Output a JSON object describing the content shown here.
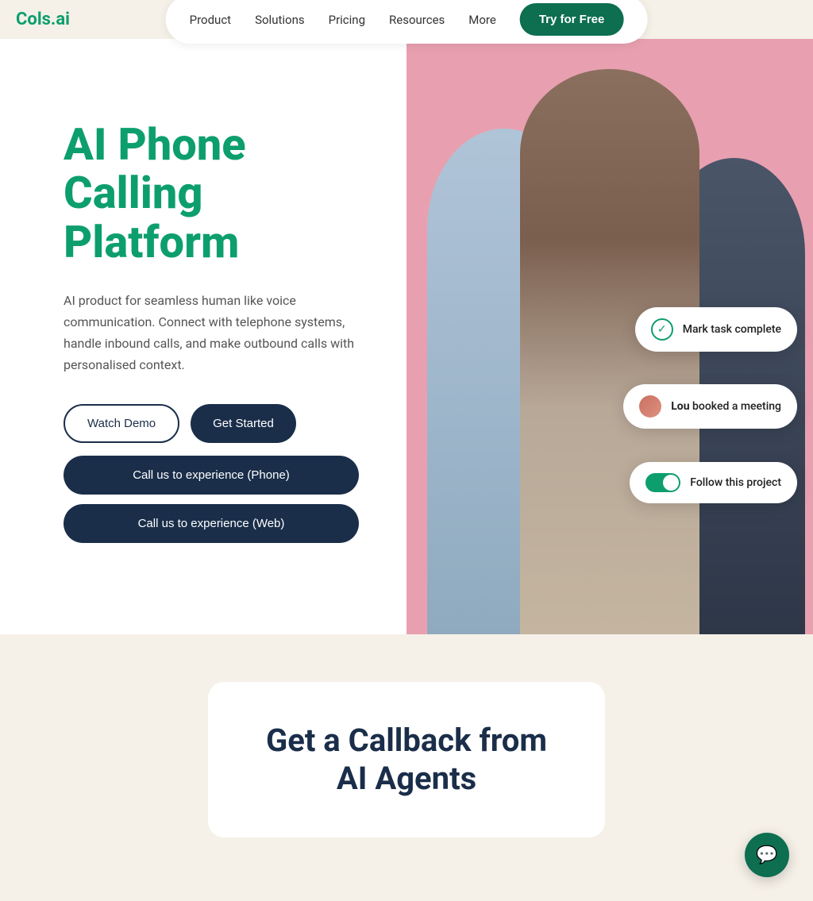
{
  "nav": {
    "logo": "Cols.ai",
    "links": [
      "Product",
      "Solutions",
      "Pricing",
      "Resources",
      "More"
    ],
    "cta": "Try for Free"
  },
  "hero": {
    "title": "AI Phone Calling Platform",
    "subtitle": "AI product for seamless human like voice communication. Connect with telephone systems, handle inbound calls, and make outbound calls with personalised context.",
    "btn_watch": "Watch Demo",
    "btn_started": "Get Started",
    "btn_phone": "Call us to experience (Phone)",
    "btn_web": "Call us to experience (Web)"
  },
  "floating_cards": {
    "mark_task": "Mark task complete",
    "lou_text_pre": "Lou",
    "lou_text_post": " booked a meeting",
    "follow_project": "Follow this project"
  },
  "bottom": {
    "title": "Get a Callback from AI Agents"
  },
  "chat_fab": "💬"
}
